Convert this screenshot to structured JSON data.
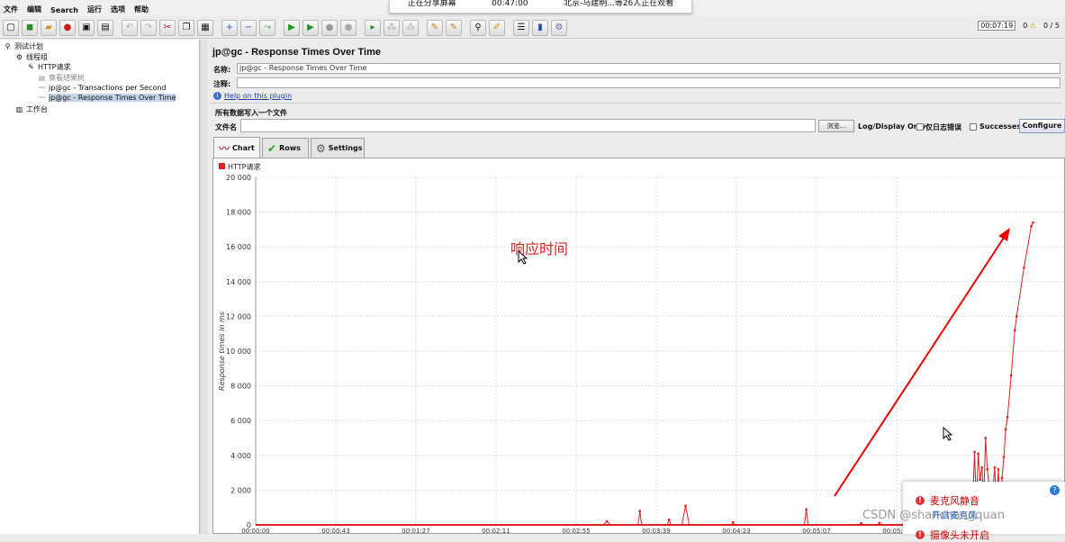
{
  "share_banner": {
    "status": "正在分享屏幕",
    "time": "00:47:00",
    "viewers": "北京-马建明...等26人正在观看"
  },
  "menu": [
    "文件",
    "编辑",
    "Search",
    "运行",
    "选项",
    "帮助"
  ],
  "toolbar_status": {
    "elapsed": "00:07:19",
    "warnings": "0",
    "threads": "0 / 5"
  },
  "tree": {
    "items": [
      {
        "label": "测试计划",
        "icon": "test-plan-icon"
      },
      {
        "label": "线程组",
        "icon": "thread-group-icon"
      },
      {
        "label": "HTTP请求",
        "icon": "sampler-icon"
      },
      {
        "label": "察看结果树",
        "icon": "listener-icon"
      },
      {
        "label": "jp@gc - Transactions per Second",
        "icon": "graph-icon"
      },
      {
        "label": "jp@gc - Response Times Over Time",
        "icon": "graph-icon"
      },
      {
        "label": "工作台",
        "icon": "workbench-icon"
      }
    ]
  },
  "panel": {
    "title": "jp@gc - Response Times Over Time",
    "name_label": "名称:",
    "name_value": "jp@gc - Response Times Over Time",
    "comment_label": "注释:",
    "comment_value": "",
    "help_link": "Help on this plugin",
    "write_all_label": "所有数据写入一个文件",
    "filename_label": "文件名",
    "filename_value": "",
    "browse_label": "浏览...",
    "log_display_label": "Log/Display Only:",
    "errors_label": "仅日志错误",
    "successes_label": "Successes",
    "configure_label": "Configure"
  },
  "tabs": [
    {
      "label": "Chart",
      "icon": "chart-icon",
      "active": true
    },
    {
      "label": "Rows",
      "icon": "checkmark-icon",
      "active": false
    },
    {
      "label": "Settings",
      "icon": "gear-icon",
      "active": false
    }
  ],
  "annotation_text": "响应时间",
  "notification": {
    "line1": "麦克风静音",
    "link": "开启麦克风",
    "line2": "摄像头未开启"
  },
  "watermark": "CSDN @shanchangquan",
  "chart_data": {
    "type": "line",
    "title": "",
    "legend": [
      "HTTP请求"
    ],
    "legend_position": "top-left",
    "ylabel": "Response times in ms",
    "xlabel": "",
    "ylim": [
      0,
      20000
    ],
    "y_ticks": [
      "0",
      "2 000",
      "4 000",
      "6 000",
      "8 000",
      "10 000",
      "12 000",
      "14 000",
      "16 000",
      "18 000",
      "20 000"
    ],
    "x_ticks": [
      "00:00:00",
      "00:00:43",
      "00:01:27",
      "00:02:11",
      "00:02:55",
      "00:03:39",
      "00:04:23",
      "00:05:07",
      "00:05:51"
    ],
    "grid": true,
    "colors": {
      "series": "#e02020",
      "grid": "#dcdcdc",
      "arrow": "#ee0000"
    },
    "series": [
      {
        "name": "HTTP请求",
        "points": [
          [
            0,
            0
          ],
          [
            190,
            0
          ],
          [
            192,
            200
          ],
          [
            194,
            0
          ],
          [
            209,
            0
          ],
          [
            210,
            800
          ],
          [
            211,
            0
          ],
          [
            225,
            0
          ],
          [
            226,
            300
          ],
          [
            227,
            0
          ],
          [
            233,
            0
          ],
          [
            235,
            1100
          ],
          [
            237,
            0
          ],
          [
            260,
            0
          ],
          [
            261,
            150
          ],
          [
            262,
            0
          ],
          [
            300,
            0
          ],
          [
            301,
            900
          ],
          [
            302,
            0
          ],
          [
            330,
            0
          ],
          [
            331,
            100
          ],
          [
            332,
            0
          ],
          [
            340,
            0
          ],
          [
            341,
            120
          ],
          [
            342,
            0
          ],
          [
            355,
            0
          ],
          [
            356,
            200
          ],
          [
            357,
            0
          ],
          [
            365,
            0
          ],
          [
            366,
            100
          ],
          [
            367,
            0
          ],
          [
            372,
            0
          ],
          [
            373,
            300
          ],
          [
            374,
            0
          ],
          [
            375,
            1000
          ],
          [
            376,
            600
          ],
          [
            377,
            0
          ],
          [
            378,
            200
          ],
          [
            380,
            0
          ],
          [
            382,
            300
          ],
          [
            384,
            200
          ],
          [
            386,
            0
          ],
          [
            388,
            400
          ],
          [
            389,
            800
          ],
          [
            390,
            0
          ],
          [
            391,
            1800
          ],
          [
            392,
            1400
          ],
          [
            393,
            4200
          ],
          [
            394,
            1000
          ],
          [
            395,
            4100
          ],
          [
            396,
            2600
          ],
          [
            397,
            3300
          ],
          [
            398,
            1500
          ],
          [
            399,
            5000
          ],
          [
            400,
            3200
          ],
          [
            401,
            2200
          ],
          [
            402,
            1800
          ],
          [
            403,
            2000
          ],
          [
            404,
            3300
          ],
          [
            405,
            1200
          ],
          [
            406,
            3200
          ],
          [
            407,
            800
          ],
          [
            408,
            2700
          ],
          [
            409,
            3900
          ],
          [
            410,
            5500
          ],
          [
            411,
            6200
          ],
          [
            413,
            8600
          ],
          [
            415,
            11200
          ],
          [
            416,
            12000
          ],
          [
            420,
            14800
          ],
          [
            424,
            17200
          ],
          [
            425,
            17400
          ]
        ]
      }
    ],
    "x_range_seconds": [
      0,
      425
    ]
  }
}
